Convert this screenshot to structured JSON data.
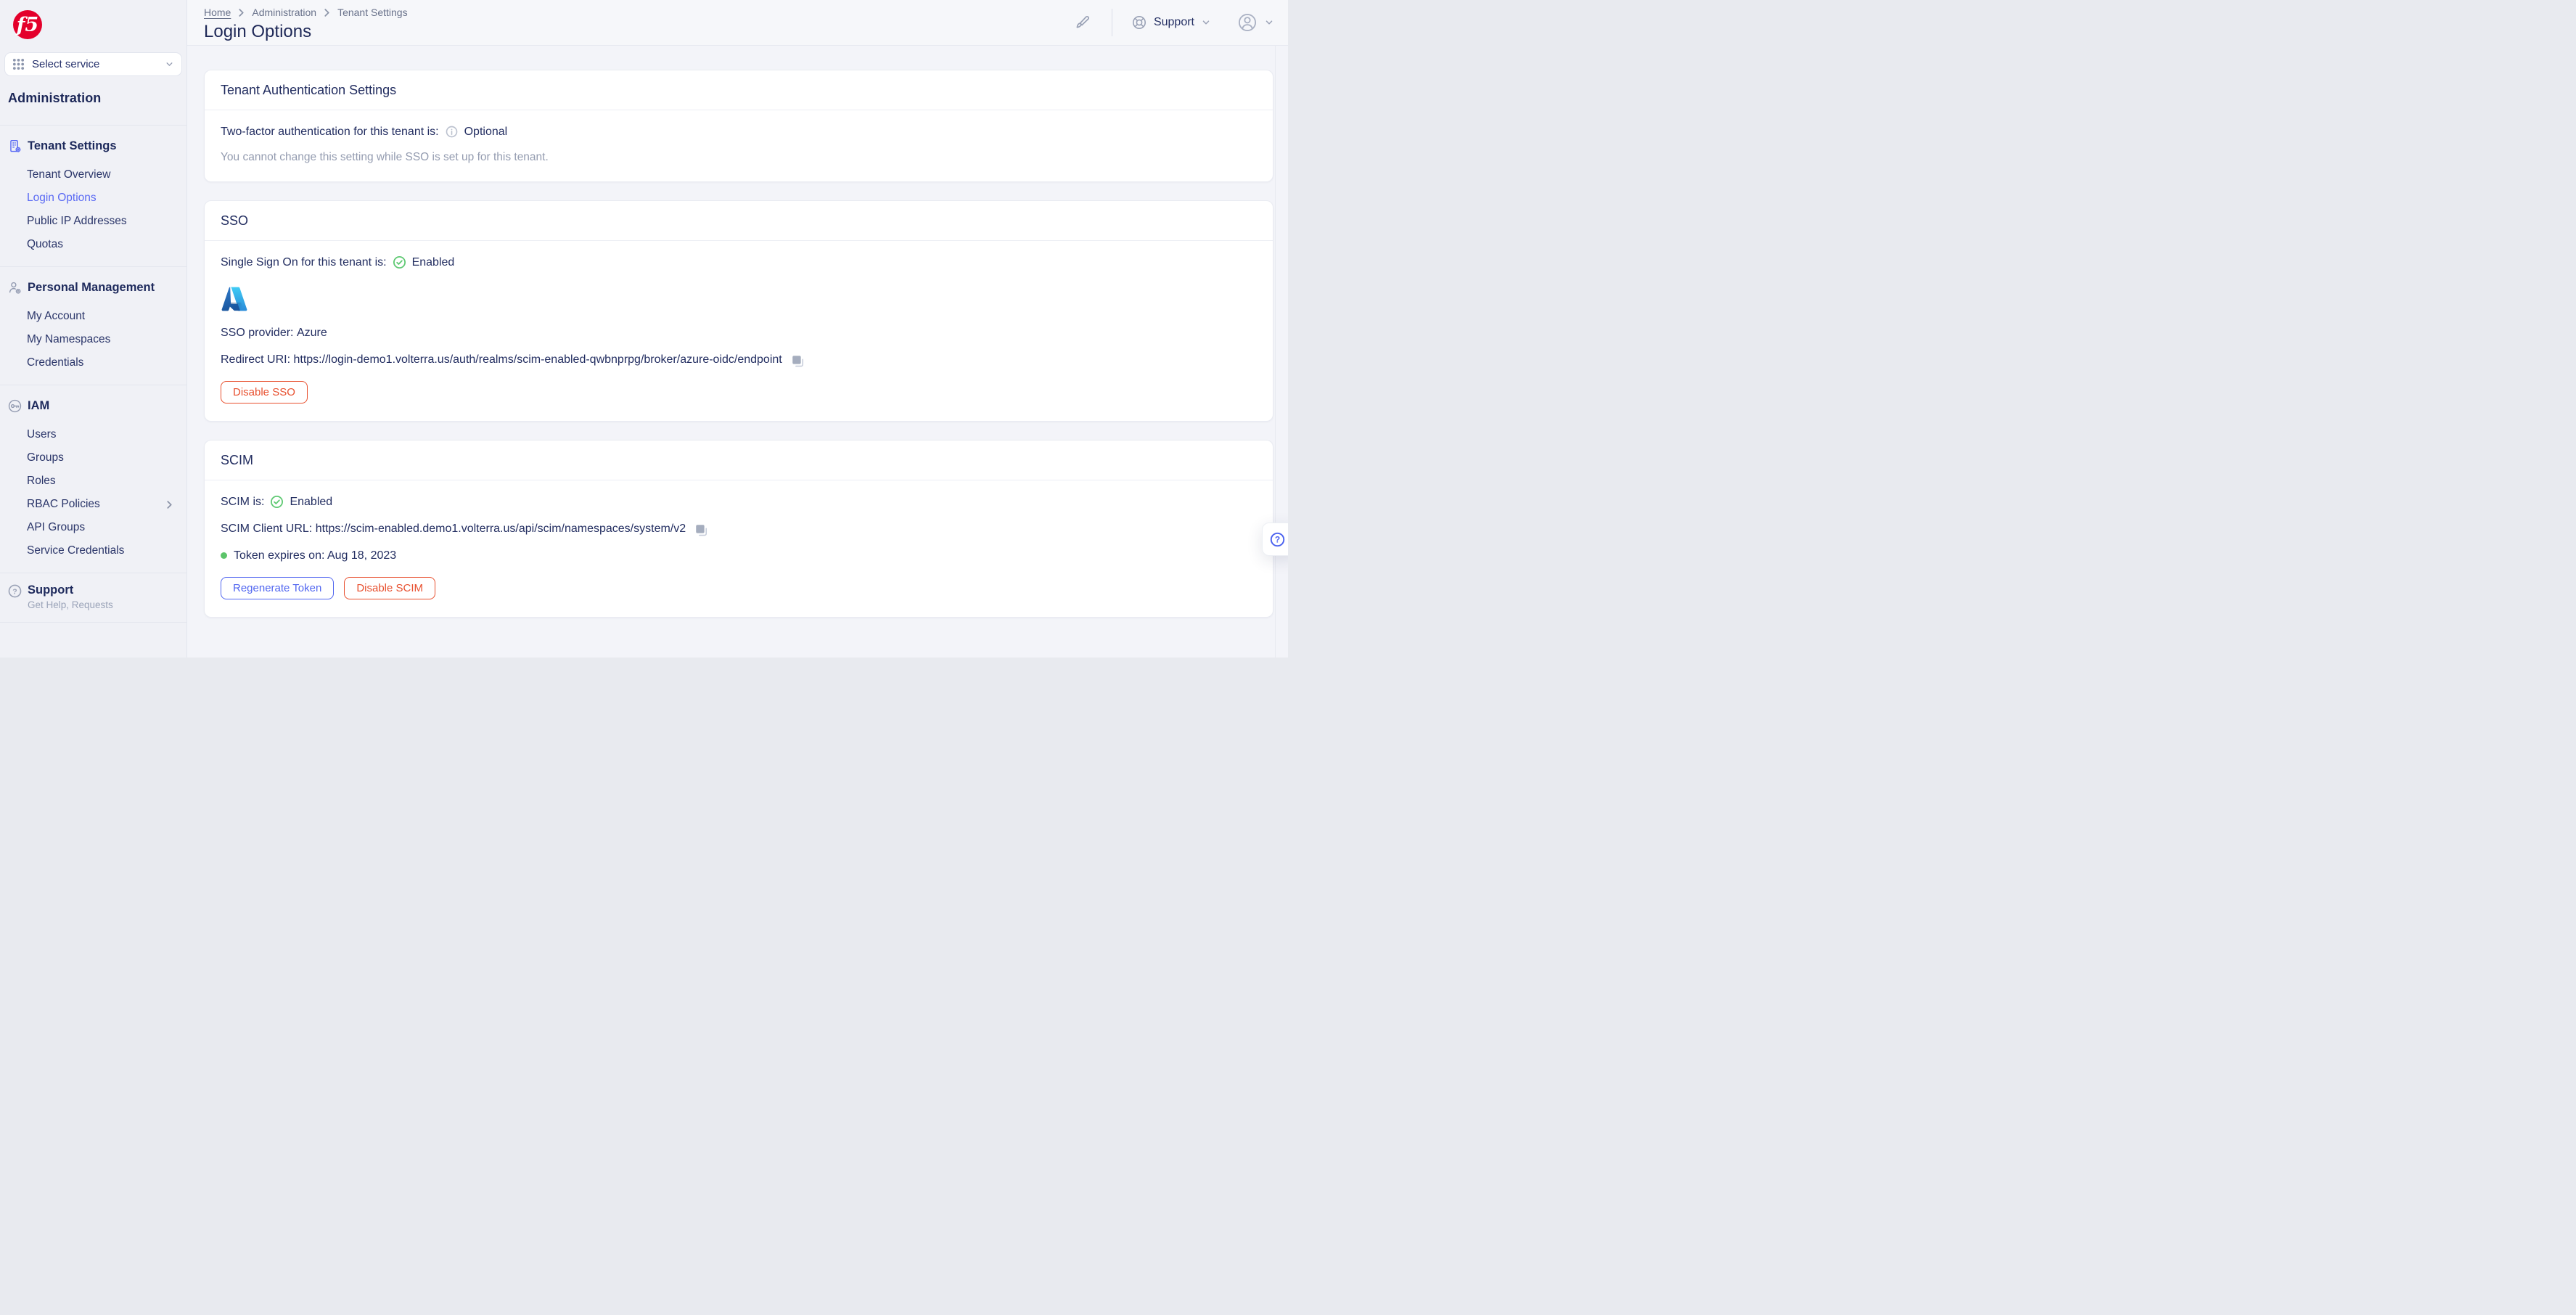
{
  "brand": {
    "logo_text": "f5"
  },
  "colors": {
    "brand_red": "#e4002b",
    "accent_blue": "#5a6af4",
    "danger_red": "#e8502f",
    "primary_blue": "#5166f0",
    "success_green": "#5fc973",
    "navy_text": "#232e61"
  },
  "sidebar": {
    "service_selector": {
      "label": "Select service"
    },
    "app_title": "Administration",
    "sections": [
      {
        "id": "tenant-settings",
        "icon": "building-gear",
        "title": "Tenant Settings",
        "items": [
          {
            "label": "Tenant Overview"
          },
          {
            "label": "Login Options",
            "active": true
          },
          {
            "label": "Public IP Addresses"
          },
          {
            "label": "Quotas"
          }
        ]
      },
      {
        "id": "personal-management",
        "icon": "person-gear",
        "title": "Personal Management",
        "items": [
          {
            "label": "My Account"
          },
          {
            "label": "My Namespaces"
          },
          {
            "label": "Credentials"
          }
        ]
      },
      {
        "id": "iam",
        "icon": "key",
        "title": "IAM",
        "items": [
          {
            "label": "Users"
          },
          {
            "label": "Groups"
          },
          {
            "label": "Roles"
          },
          {
            "label": "RBAC Policies",
            "chevron": true
          },
          {
            "label": "API Groups"
          },
          {
            "label": "Service Credentials"
          }
        ]
      }
    ],
    "support": {
      "title": "Support",
      "subtitle": "Get Help, Requests"
    }
  },
  "header": {
    "breadcrumb": [
      {
        "label": "Home"
      },
      {
        "label": "Administration"
      },
      {
        "label": "Tenant Settings"
      }
    ],
    "page_title": "Login Options",
    "support_label": "Support"
  },
  "cards": {
    "tenant_auth": {
      "title": "Tenant Authentication Settings",
      "status_label": "Two-factor authentication for this tenant is:",
      "status_value": "Optional",
      "note": "You cannot change this setting while SSO is set up for this tenant."
    },
    "sso": {
      "title": "SSO",
      "status_label": "Single Sign On for this tenant is:",
      "status_value": "Enabled",
      "provider_label": "SSO provider:",
      "provider": "Azure",
      "redirect_label": "Redirect URI:",
      "redirect_uri": "https://login-demo1.volterra.us/auth/realms/scim-enabled-qwbnprpg/broker/azure-oidc/endpoint",
      "disable_button": "Disable SSO"
    },
    "scim": {
      "title": "SCIM",
      "status_label": "SCIM is:",
      "status_value": "Enabled",
      "url_label": "SCIM Client URL:",
      "client_url": "https://scim-enabled.demo1.volterra.us/api/scim/namespaces/system/v2",
      "token_expiry": "Token expires on: Aug 18, 2023",
      "regenerate_button": "Regenerate Token",
      "disable_button": "Disable SCIM"
    }
  }
}
